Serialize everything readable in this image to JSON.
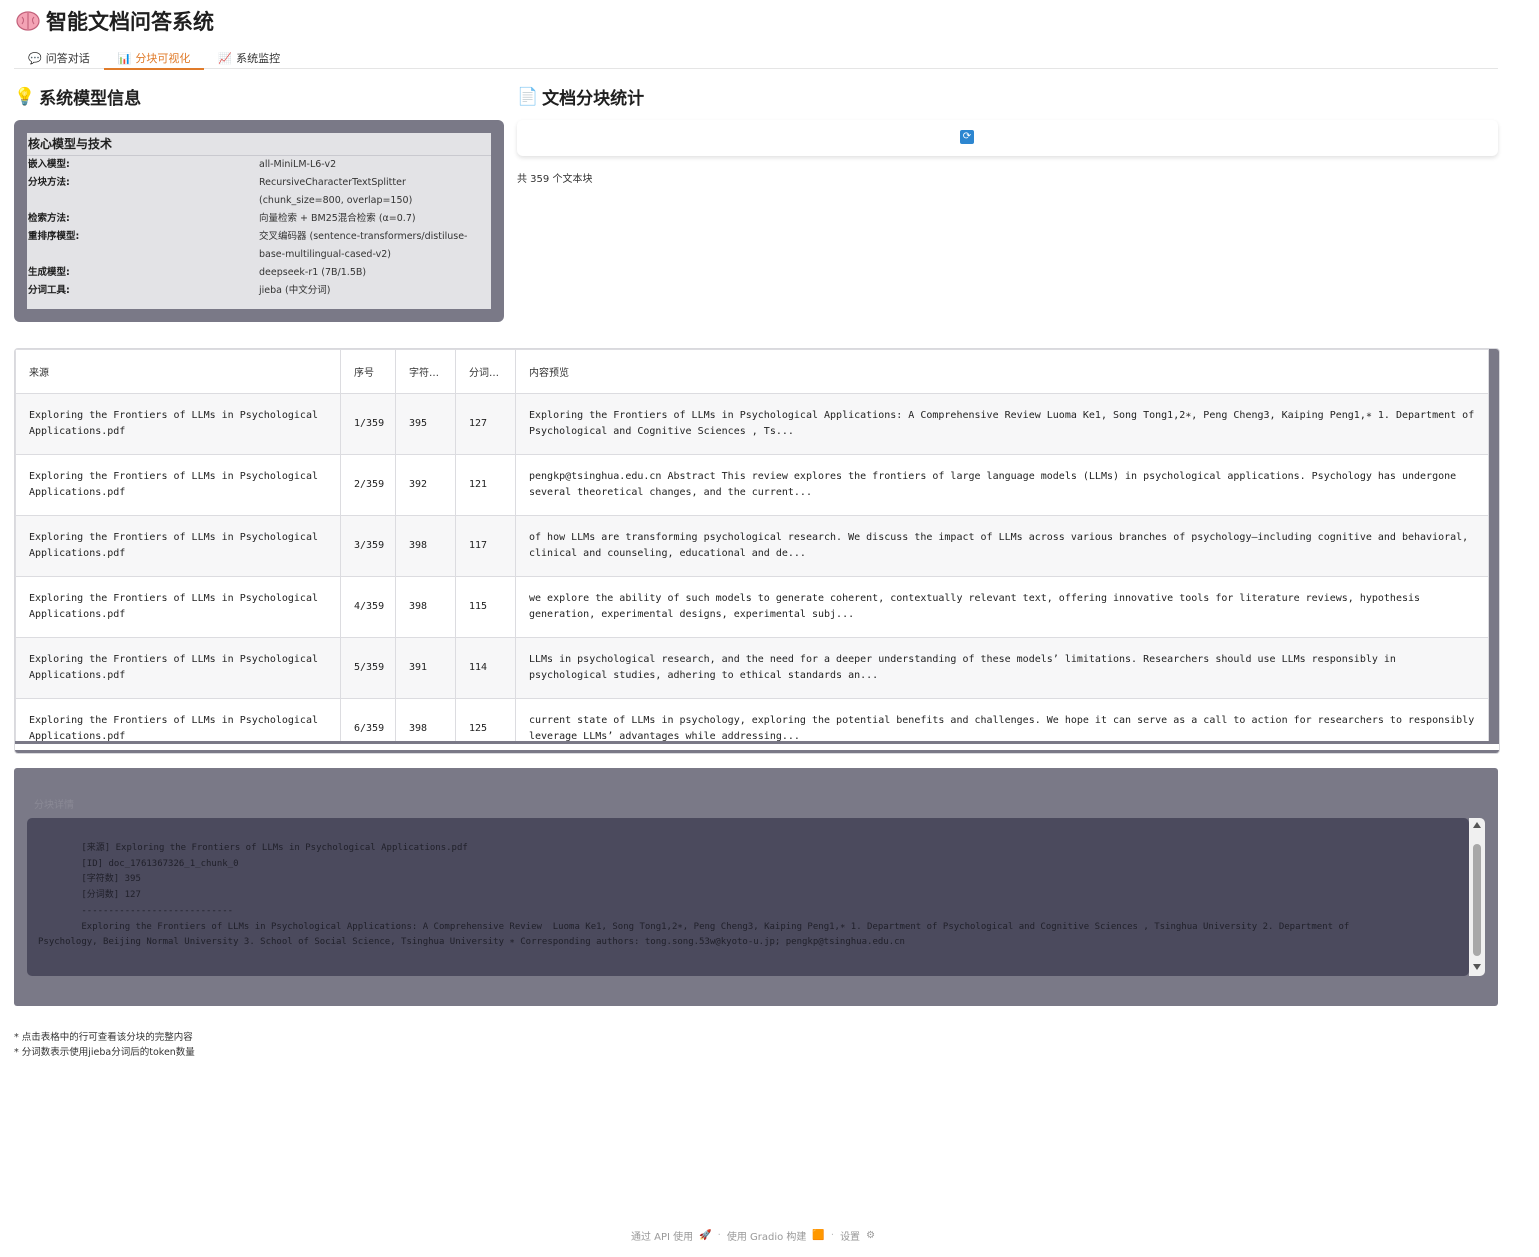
{
  "app": {
    "title": "智能文档问答系统",
    "title_icon": "brain-icon"
  },
  "tabs": [
    {
      "label": "问答对话",
      "icon": "chat-icon",
      "active": false
    },
    {
      "label": "分块可视化",
      "icon": "bar-chart-icon",
      "active": true
    },
    {
      "label": "系统监控",
      "icon": "monitor-chart-icon",
      "active": false
    }
  ],
  "model_section": {
    "heading": "系统模型信息",
    "icon": "lightbulb-icon",
    "table_caption": "核心模型与技术",
    "rows": [
      {
        "key": "嵌入模型:",
        "value": "all-MiniLM-L6-v2"
      },
      {
        "key": "分块方法:",
        "value": "RecursiveCharacterTextSplitter (chunk_size=800, overlap=150)"
      },
      {
        "key": "检索方法:",
        "value": "向量检索 + BM25混合检索 (α=0.7)"
      },
      {
        "key": "重排序模型:",
        "value": "交叉编码器 (sentence-transformers/distiluse-base-multilingual-cased-v2)"
      },
      {
        "key": "生成模型:",
        "value": "deepseek-r1 (7B/1.5B)"
      },
      {
        "key": "分词工具:",
        "value": "jieba (中文分词)"
      }
    ]
  },
  "stats_section": {
    "heading": "文档分块统计",
    "icon": "document-icon",
    "count_text": "共 359 个文本块"
  },
  "chunk_table": {
    "headers": [
      "来源",
      "序号",
      "字符…",
      "分词…",
      "内容预览"
    ],
    "rows": [
      {
        "source": "Exploring the Frontiers of LLMs in Psychological Applications.pdf",
        "index": "1/359",
        "chars": "395",
        "tokens": "127",
        "preview": "Exploring the Frontiers of LLMs in Psychological Applications: A Comprehensive Review Luoma Ke1, Song Tong1,2∗, Peng Cheng3, Kaiping Peng1,∗ 1. Department of Psychological and Cognitive Sciences , Ts..."
      },
      {
        "source": "Exploring the Frontiers of LLMs in Psychological Applications.pdf",
        "index": "2/359",
        "chars": "392",
        "tokens": "121",
        "preview": "pengkp@tsinghua.edu.cn Abstract This review explores the frontiers of large language models (LLMs) in psychological applications. Psychology has undergone several theoretical changes, and the current..."
      },
      {
        "source": "Exploring the Frontiers of LLMs in Psychological Applications.pdf",
        "index": "3/359",
        "chars": "398",
        "tokens": "117",
        "preview": "of how LLMs are transforming psychological research. We discuss the impact of LLMs across various branches of psychology—including cognitive and behavioral, clinical and counseling, educational and de..."
      },
      {
        "source": "Exploring the Frontiers of LLMs in Psychological Applications.pdf",
        "index": "4/359",
        "chars": "398",
        "tokens": "115",
        "preview": "we explore the ability of such models to generate coherent, contextually relevant text, offering innovative tools for literature reviews, hypothesis generation, experimental designs, experimental subj..."
      },
      {
        "source": "Exploring the Frontiers of LLMs in Psychological Applications.pdf",
        "index": "5/359",
        "chars": "391",
        "tokens": "114",
        "preview": "LLMs in psychological research, and the need for a deeper understanding of these models’ limitations. Researchers should use LLMs responsibly in psychological studies, adhering to ethical standards an..."
      },
      {
        "source": "Exploring the Frontiers of LLMs in Psychological Applications.pdf",
        "index": "6/359",
        "chars": "398",
        "tokens": "125",
        "preview": "current state of LLMs in psychology, exploring the potential benefits and challenges. We hope it can serve as a call to action for researchers to responsibly leverage LLMs’ advantages while addressing..."
      }
    ]
  },
  "detail": {
    "label": "分块详情",
    "content": "        [来源] Exploring the Frontiers of LLMs in Psychological Applications.pdf\n        [ID] doc_1761367326_1_chunk_0\n        [字符数] 395\n        [分词数] 127\n        ----------------------------\n        Exploring the Frontiers of LLMs in Psychological Applications: A Comprehensive Review  Luoma Ke1, Song Tong1,2∗, Peng Cheng3, Kaiping Peng1,∗ 1. Department of Psychological and Cognitive Sciences , Tsinghua University 2. Department of Psychology, Beijing Normal University 3. School of Social Science, Tsinghua University ∗ Corresponding authors: tong.song.53w@kyoto-u.jp; pengkp@tsinghua.edu.cn"
  },
  "notes": [
    "* 点击表格中的行可查看该分块的完整内容",
    "* 分词数表示使用jieba分词后的token数量"
  ],
  "footer": {
    "api": "通过 API 使用",
    "built": "使用 Gradio 构建",
    "settings": "设置"
  },
  "colors": {
    "accent": "#e07b2a",
    "panel": "#7a7987",
    "code_bg": "#4b4a5d"
  }
}
